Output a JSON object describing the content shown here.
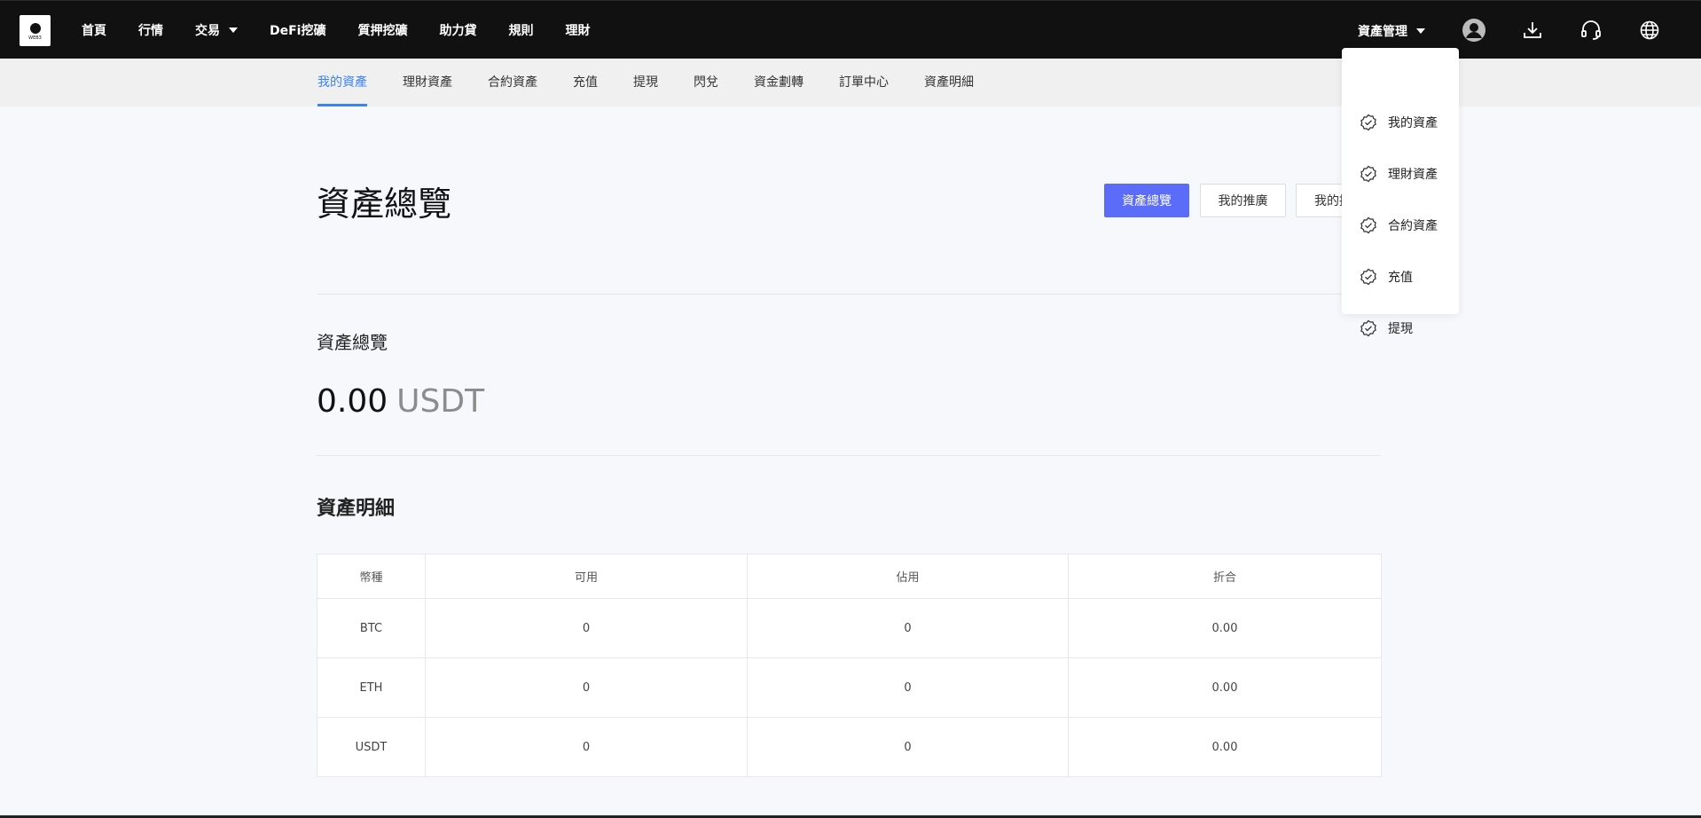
{
  "logo": {
    "text": "WEB3"
  },
  "nav": {
    "items": [
      {
        "label": "首頁"
      },
      {
        "label": "行情"
      },
      {
        "label": "交易",
        "dropdown": true
      },
      {
        "label": "DeFi挖礦"
      },
      {
        "label": "質押挖礦"
      },
      {
        "label": "助力貸"
      },
      {
        "label": "規則"
      },
      {
        "label": "理財"
      }
    ]
  },
  "header_right": {
    "asset_management": "資產管理",
    "icons": [
      "user-avatar-icon",
      "download-icon",
      "headset-icon",
      "globe-icon"
    ]
  },
  "subnav": {
    "items": [
      "我的資產",
      "理財資產",
      "合約資產",
      "充值",
      "提現",
      "閃兌",
      "資金劃轉",
      "訂單中心",
      "資產明細"
    ],
    "active_index": 0
  },
  "page": {
    "title": "資產總覽",
    "buttons": [
      "資產總覽",
      "我的推廣",
      "我的推"
    ],
    "overview_label": "資產總覽",
    "balance_value": "0.00",
    "balance_unit": "USDT",
    "detail_title": "資產明細"
  },
  "table": {
    "headers": [
      "幣種",
      "可用",
      "佔用",
      "折合"
    ],
    "rows": [
      [
        "BTC",
        "0",
        "0",
        "0.00"
      ],
      [
        "ETH",
        "0",
        "0",
        "0.00"
      ],
      [
        "USDT",
        "0",
        "0",
        "0.00"
      ]
    ]
  },
  "dropdown": {
    "items": [
      "我的資產",
      "理財資產",
      "合約資產",
      "充值",
      "提現"
    ]
  },
  "colors": {
    "topbar": "#111111",
    "accent": "#3b82f6",
    "primary_button": "#5b6cf9",
    "subnav_bg": "#f0f0f0",
    "page_bg": "#f7f8fc"
  }
}
